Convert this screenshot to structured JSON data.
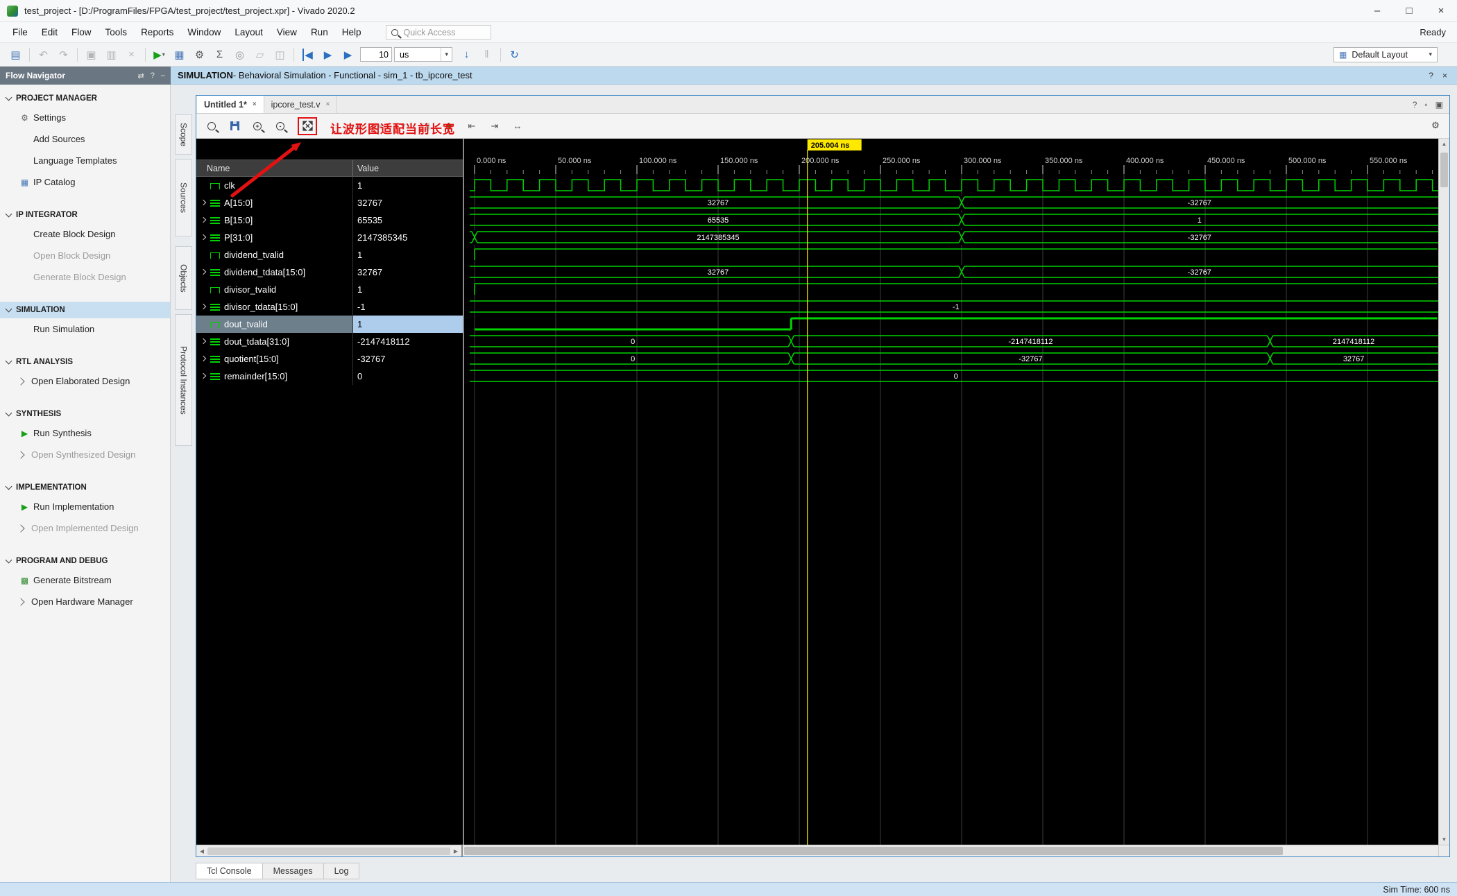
{
  "window_title": "test_project - [D:/ProgramFiles/FPGA/test_project/test_project.xpr] - Vivado 2020.2",
  "window_controls": {
    "minimize": "–",
    "maximize": "□",
    "close": "×"
  },
  "carets": {
    "down": "▾"
  },
  "scrollbar": {
    "up": "▲",
    "down": "▼",
    "left": "◀",
    "right": "▶"
  },
  "menu_bar": {
    "items": [
      "File",
      "Edit",
      "Flow",
      "Tools",
      "Reports",
      "Window",
      "Layout",
      "View",
      "Run",
      "Help"
    ],
    "quick_access_placeholder": "Quick Access",
    "ready_status": "Ready"
  },
  "toolbar": {
    "buttons_a": [
      {
        "name": "open-recent-icon",
        "glyph": "▤",
        "color": "#4a78b8"
      },
      {
        "sep": true
      },
      {
        "name": "undo-icon",
        "glyph": "↶",
        "disabled": true
      },
      {
        "name": "redo-icon",
        "glyph": "↷",
        "disabled": true
      },
      {
        "sep": true
      },
      {
        "name": "copy-icon",
        "glyph": "▣",
        "disabled": true
      },
      {
        "name": "paste-icon",
        "glyph": "▥",
        "disabled": true
      },
      {
        "name": "delete-icon",
        "glyph": "×",
        "disabled": true
      },
      {
        "sep": true
      },
      {
        "name": "run-flow-icon",
        "glyph": "▶",
        "color": "#18a018",
        "caret": true
      },
      {
        "name": "flow-dashboard-icon",
        "glyph": "▦",
        "color": "#4a78b8"
      },
      {
        "name": "settings-gear-icon",
        "glyph": "⚙",
        "color": "#555555"
      },
      {
        "name": "report-sigma-icon",
        "glyph": "Σ",
        "color": "#555555"
      },
      {
        "name": "probe-icon",
        "glyph": "◎",
        "color": "#999999"
      },
      {
        "name": "edit-marker-icon",
        "glyph": "▱",
        "disabled": true
      },
      {
        "name": "breakpoint-icon",
        "glyph": "◫",
        "disabled": true
      },
      {
        "sep": true
      },
      {
        "name": "restart-sim-icon",
        "glyph": "◀",
        "color": "#2a6fc0",
        "bar": true
      },
      {
        "name": "run-all-icon",
        "glyph": "▶",
        "color": "#2a6fc0"
      },
      {
        "name": "run-for-time-icon",
        "glyph": "▶",
        "color": "#2a6fc0"
      }
    ],
    "sim_time_value": "10",
    "sim_time_unit": "us",
    "buttons_b": [
      {
        "name": "step-icon",
        "glyph": "↓",
        "color": "#2a6fc0"
      },
      {
        "name": "pause-icon",
        "glyph": "‖",
        "disabled": true
      },
      {
        "sep": true
      },
      {
        "name": "relaunch-icon",
        "glyph": "↻",
        "color": "#2a6fc0"
      }
    ],
    "layout_selector": "Default Layout"
  },
  "context_banner": {
    "heading": "SIMULATION",
    "detail": " - Behavioral Simulation - Functional - sim_1 - tb_ipcore_test",
    "icons": [
      {
        "name": "banner-help-icon",
        "glyph": "?"
      },
      {
        "name": "banner-close-icon",
        "glyph": "×"
      }
    ]
  },
  "flow_navigator": {
    "title": "Flow Navigator",
    "header_icons": [
      {
        "name": "panel-toggle-icon",
        "glyph": "⇄"
      },
      {
        "name": "panel-help-icon",
        "glyph": "?"
      },
      {
        "name": "panel-minimize-icon",
        "glyph": "–"
      }
    ],
    "sections": [
      {
        "label": "PROJECT MANAGER",
        "items": [
          {
            "label": "Settings",
            "icon": "gear"
          },
          {
            "label": "Add Sources"
          },
          {
            "label": "Language Templates"
          },
          {
            "label": "IP Catalog",
            "icon": "grid"
          }
        ]
      },
      {
        "label": "IP INTEGRATOR",
        "items": [
          {
            "label": "Create Block Design"
          },
          {
            "label": "Open Block Design",
            "disabled": true
          },
          {
            "label": "Generate Block Design",
            "disabled": true
          }
        ]
      },
      {
        "label": "SIMULATION",
        "selected": true,
        "items": [
          {
            "label": "Run Simulation"
          }
        ]
      },
      {
        "label": "RTL ANALYSIS",
        "items": [
          {
            "label": "Open Elaborated Design",
            "chevron": true
          }
        ]
      },
      {
        "label": "SYNTHESIS",
        "items": [
          {
            "label": "Run Synthesis",
            "icon": "play"
          },
          {
            "label": "Open Synthesized Design",
            "chevron": true,
            "disabled": true
          }
        ]
      },
      {
        "label": "IMPLEMENTATION",
        "items": [
          {
            "label": "Run Implementation",
            "icon": "play"
          },
          {
            "label": "Open Implemented Design",
            "chevron": true,
            "disabled": true
          }
        ]
      },
      {
        "label": "PROGRAM AND DEBUG",
        "items": [
          {
            "label": "Generate Bitstream",
            "icon": "bitstream"
          },
          {
            "label": "Open Hardware Manager",
            "chevron": true
          }
        ]
      }
    ]
  },
  "icon_glyphs": {
    "gear": "⚙",
    "grid": "▦",
    "play": "▶",
    "bitstream": "▩"
  },
  "icon_colors": {
    "gear": "#666666",
    "grid": "#4a78b8",
    "play": "#18a018",
    "bitstream": "#2e8b2e"
  },
  "side_tabs": [
    {
      "label": "Scope"
    },
    {
      "label": "Sources"
    },
    {
      "label": "Objects"
    },
    {
      "label": "Protocol Instances"
    }
  ],
  "editor_tabs": [
    {
      "label": "Untitled 1*",
      "active": true
    },
    {
      "label": "ipcore_test.v",
      "active": false
    }
  ],
  "tab_strip_icons": [
    {
      "name": "tab-help-icon",
      "glyph": "?"
    },
    {
      "name": "float-window-icon",
      "glyph": "▫"
    },
    {
      "name": "maximize-window-icon",
      "glyph": "▣"
    }
  ],
  "wave_toolbar": {
    "buttons": [
      {
        "name": "find-icon",
        "type": "mag",
        "mod": ""
      },
      {
        "name": "save-waveform-icon",
        "type": "floppy"
      },
      {
        "name": "zoom-in-icon",
        "type": "mag",
        "mod": "+"
      },
      {
        "name": "zoom-out-icon",
        "type": "mag",
        "mod": "-"
      },
      {
        "name": "zoom-fit-icon",
        "type": "fit",
        "highlight": true
      },
      {
        "name": "zoom-to-cursor-icon",
        "glyph": "▭",
        "disabled": true
      },
      {
        "name": "previous-transition-icon",
        "glyph": "◄",
        "disabled": true
      },
      {
        "name": "next-transition-icon",
        "glyph": "►",
        "disabled": true
      },
      {
        "name": "add-marker-icon",
        "glyph": "▼",
        "disabled": true
      },
      {
        "name": "swap-cursors-icon",
        "glyph": "◨",
        "disabled": true
      },
      {
        "name": "add-signal-icon",
        "type": "plus"
      },
      {
        "name": "go-to-time-zero-icon",
        "glyph": "⇤",
        "color": "#555555"
      },
      {
        "name": "go-to-last-time-icon",
        "glyph": "⇥",
        "color": "#555555"
      },
      {
        "name": "time-range-icon",
        "glyph": "↔",
        "color": "#555555"
      }
    ],
    "settings_glyph": "⚙",
    "annotation_text": "让波形图适配当前长宽"
  },
  "waveform": {
    "cursor_ns": 205.004,
    "cursor_label": "205.004 ns",
    "time_end_ns": 593,
    "tick_interval_ns": 50,
    "clock_period_ns": 20,
    "tick_labels": [
      "0.000 ns",
      "50.000 ns",
      "100.000 ns",
      "150.000 ns",
      "200.000 ns",
      "250.000 ns",
      "300.000 ns",
      "350.000 ns",
      "400.000 ns",
      "450.000 ns",
      "500.000 ns",
      "550.000 ns"
    ],
    "header": {
      "name": "Name",
      "value": "Value"
    },
    "signals": [
      {
        "name": "clk",
        "value": "1",
        "kind": "clock"
      },
      {
        "name": "A[15:0]",
        "value": "32767",
        "kind": "bus",
        "expandable": true,
        "segments": [
          {
            "from": 0,
            "to": 300,
            "label": "32767"
          },
          {
            "from": 300,
            "to": 593,
            "label": "-32767"
          }
        ]
      },
      {
        "name": "B[15:0]",
        "value": "65535",
        "kind": "bus",
        "expandable": true,
        "segments": [
          {
            "from": 0,
            "to": 300,
            "label": "65535"
          },
          {
            "from": 300,
            "to": 593,
            "label": "1"
          }
        ]
      },
      {
        "name": "P[31:0]",
        "value": "2147385345",
        "kind": "bus",
        "expandable": true,
        "x_at_start": true,
        "segments": [
          {
            "from": 0,
            "to": 300,
            "label": "2147385345"
          },
          {
            "from": 300,
            "to": 593,
            "label": "-32767"
          }
        ]
      },
      {
        "name": "dividend_tvalid",
        "value": "1",
        "kind": "scalar",
        "levels": [
          {
            "from": 0,
            "to": 593,
            "level": 1
          }
        ]
      },
      {
        "name": "dividend_tdata[15:0]",
        "value": "32767",
        "kind": "bus",
        "expandable": true,
        "segments": [
          {
            "from": 0,
            "to": 300,
            "label": "32767"
          },
          {
            "from": 300,
            "to": 593,
            "label": "-32767"
          }
        ]
      },
      {
        "name": "divisor_tvalid",
        "value": "1",
        "kind": "scalar",
        "levels": [
          {
            "from": 0,
            "to": 593,
            "level": 1
          }
        ]
      },
      {
        "name": "divisor_tdata[15:0]",
        "value": "-1",
        "kind": "bus",
        "expandable": true,
        "segments": [
          {
            "from": 0,
            "to": 593,
            "label": "-1"
          }
        ]
      },
      {
        "name": "dout_tvalid",
        "value": "1",
        "kind": "scalar",
        "selected": true,
        "levels": [
          {
            "from": 0,
            "to": 195,
            "level": 0
          },
          {
            "from": 195,
            "to": 593,
            "level": 1
          }
        ]
      },
      {
        "name": "dout_tdata[31:0]",
        "value": "-2147418112",
        "kind": "bus",
        "expandable": true,
        "segments": [
          {
            "from": 0,
            "to": 195,
            "label": "0"
          },
          {
            "from": 195,
            "to": 490,
            "label": "-2147418112"
          },
          {
            "from": 490,
            "to": 593,
            "label": "2147418112"
          }
        ]
      },
      {
        "name": "quotient[15:0]",
        "value": "-32767",
        "kind": "bus",
        "expandable": true,
        "segments": [
          {
            "from": 0,
            "to": 195,
            "label": "0"
          },
          {
            "from": 195,
            "to": 490,
            "label": "-32767"
          },
          {
            "from": 490,
            "to": 593,
            "label": "32767"
          }
        ]
      },
      {
        "name": "remainder[15:0]",
        "value": "0",
        "kind": "bus",
        "expandable": true,
        "segments": [
          {
            "from": 0,
            "to": 593,
            "label": "0"
          }
        ]
      }
    ]
  },
  "bottom_tabs": [
    {
      "label": "Tcl Console",
      "active": true
    },
    {
      "label": "Messages",
      "active": false
    },
    {
      "label": "Log",
      "active": false
    }
  ],
  "status_bar": {
    "sim_time": "Sim Time: 600 ns"
  },
  "colors": {
    "wave_green": "#00d400",
    "cursor_yellow": "#ffe900",
    "annotation_red": "#e31212",
    "selection_blue": "#c8dff2"
  }
}
